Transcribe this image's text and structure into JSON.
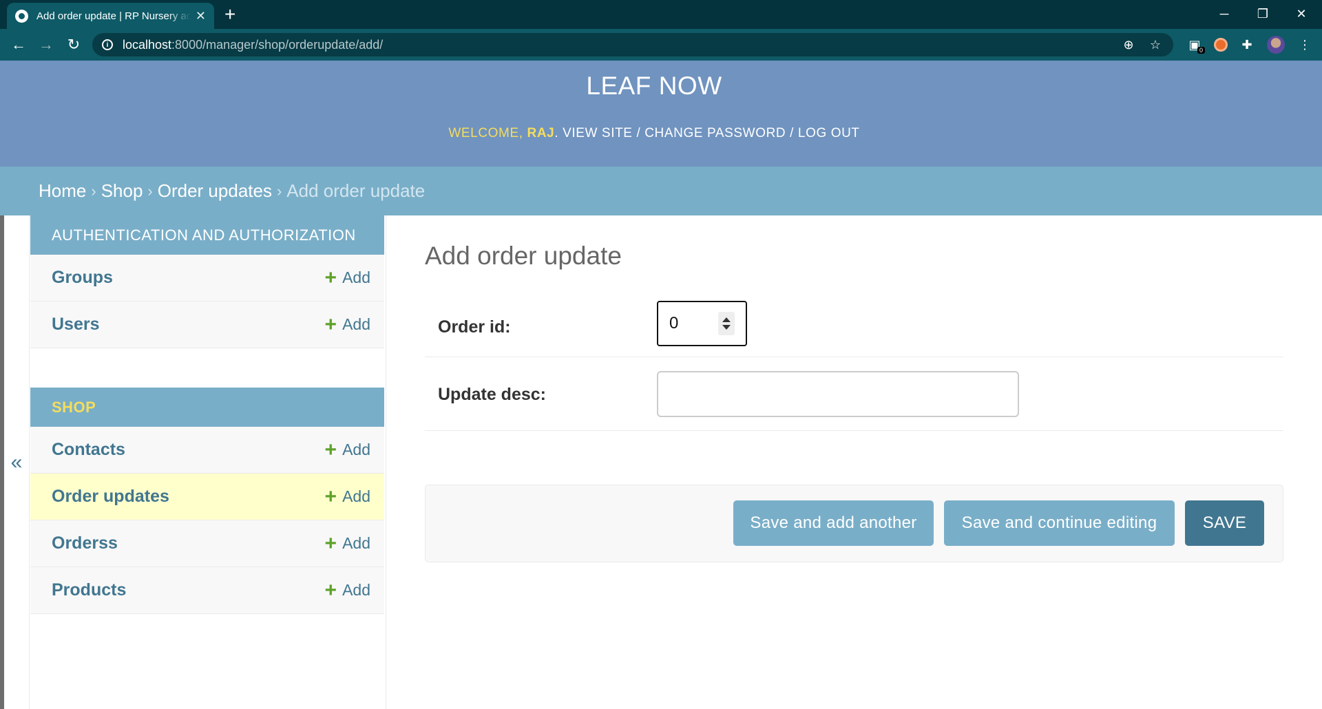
{
  "browser": {
    "tab_title": "Add order update | RP Nursery admin",
    "new_tab_icon": "+",
    "close_tab_icon": "✕",
    "url_host": "localhost",
    "url_path": ":8000/manager/shop/orderupdate/add/",
    "extension_badge": "0"
  },
  "header": {
    "site_name": "LEAF NOW",
    "welcome": "WELCOME,",
    "username": "RAJ",
    "period": ".",
    "view_site": "VIEW SITE",
    "separator": "/",
    "change_password": "CHANGE PASSWORD",
    "log_out": "LOG OUT"
  },
  "breadcrumbs": {
    "items": [
      "Home",
      "Shop",
      "Order updates",
      "Add order update"
    ],
    "separator": "›"
  },
  "nav_toggle": "«",
  "sidebar": {
    "modules": [
      {
        "caption": "AUTHENTICATION AND AUTHORIZATION",
        "models": [
          {
            "name": "Groups",
            "add": "Add"
          },
          {
            "name": "Users",
            "add": "Add"
          }
        ]
      },
      {
        "caption": "SHOP",
        "models": [
          {
            "name": "Contacts",
            "add": "Add"
          },
          {
            "name": "Order updates",
            "add": "Add"
          },
          {
            "name": "Orderss",
            "add": "Add"
          },
          {
            "name": "Products",
            "add": "Add"
          }
        ]
      }
    ],
    "plus_glyph": "+"
  },
  "form": {
    "title": "Add order update",
    "order_id_label": "Order id:",
    "order_id_value": "0",
    "update_desc_label": "Update desc:",
    "update_desc_value": ""
  },
  "buttons": {
    "save_add_another": "Save and add another",
    "save_continue": "Save and continue editing",
    "save": "SAVE"
  },
  "colors": {
    "header_bg": "#7093bf",
    "breadcrumb_bg": "#79aec8",
    "link": "#417690",
    "accent_yellow": "#f5dd5d",
    "current_row": "#ffffcc",
    "add_green": "#5ea22a"
  }
}
